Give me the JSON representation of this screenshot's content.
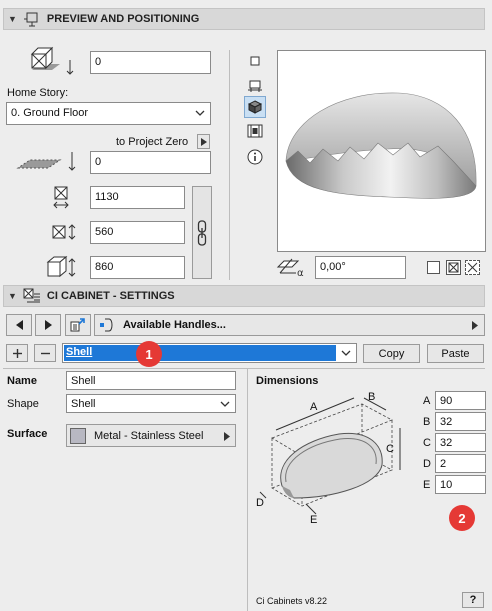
{
  "preview_section": {
    "title": "PREVIEW AND POSITIONING",
    "elevation_value": "0",
    "home_story_label": "Home Story:",
    "home_story_value": "0. Ground Floor",
    "to_project_zero_label": "to Project Zero",
    "project_zero_value": "0",
    "width_value": "1130",
    "depth_value": "560",
    "height_value": "860",
    "angle_value": "0,00°"
  },
  "settings_section": {
    "title": "CI CABINET - SETTINGS",
    "available_handles_label": "Available Handles...",
    "shell_select_value": "Shell",
    "copy_label": "Copy",
    "paste_label": "Paste",
    "name_label": "Name",
    "name_value": "Shell",
    "shape_label": "Shape",
    "shape_value": "Shell",
    "surface_label": "Surface",
    "surface_value": "Metal - Stainless Steel",
    "dimensions_label": "Dimensions",
    "dims": [
      {
        "key": "A",
        "value": "90"
      },
      {
        "key": "B",
        "value": "32"
      },
      {
        "key": "C",
        "value": "32"
      },
      {
        "key": "D",
        "value": "2"
      },
      {
        "key": "E",
        "value": "10"
      }
    ],
    "version": "Ci Cabinets v8.22",
    "help_label": "?"
  },
  "badges": {
    "one": "1",
    "two": "2"
  },
  "colors": {
    "accent_blue": "#1e78d7",
    "badge_red": "#e53935",
    "header_bg": "#d8d8d8"
  }
}
